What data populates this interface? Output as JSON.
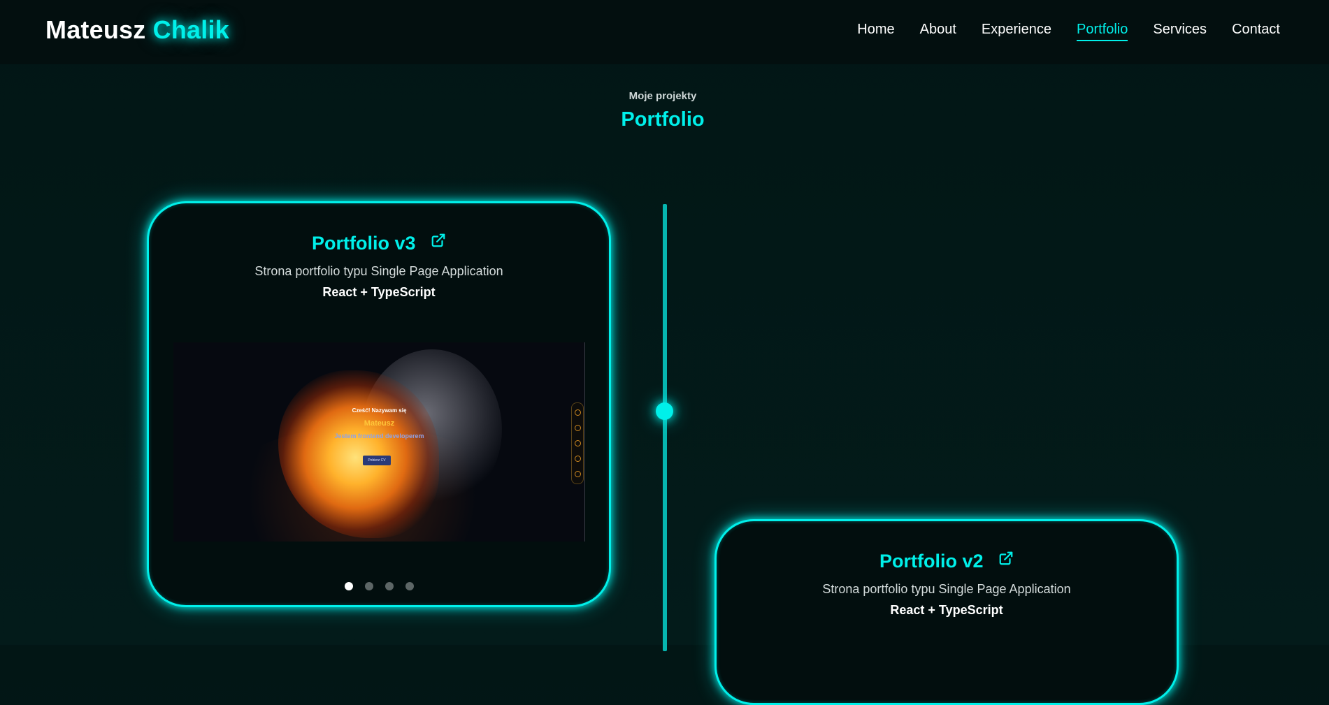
{
  "logo": {
    "first": "Mateusz",
    "last": "Chalik"
  },
  "nav": {
    "items": [
      {
        "label": "Home",
        "active": false
      },
      {
        "label": "About",
        "active": false
      },
      {
        "label": "Experience",
        "active": false
      },
      {
        "label": "Portfolio",
        "active": true
      },
      {
        "label": "Services",
        "active": false
      },
      {
        "label": "Contact",
        "active": false
      }
    ]
  },
  "section": {
    "subtitle": "Moje projekty",
    "title": "Portfolio"
  },
  "projects": [
    {
      "title": "Portfolio v3",
      "description": "Strona portfolio typu Single Page Application",
      "tech": "React + TypeScript",
      "preview": {
        "greeting": "Cześć! Nazywam się",
        "name": "Mateusz",
        "role": "Jestem frontend developerem",
        "button": "Pobierz CV"
      },
      "slides": 4,
      "active_slide": 1
    },
    {
      "title": "Portfolio v2",
      "description": "Strona portfolio typu Single Page Application",
      "tech": "React + TypeScript"
    }
  ],
  "colors": {
    "accent": "#00f0ea",
    "background": "#021615",
    "header": "#030f0f"
  },
  "icons": {
    "external_link": "external-link-icon"
  }
}
